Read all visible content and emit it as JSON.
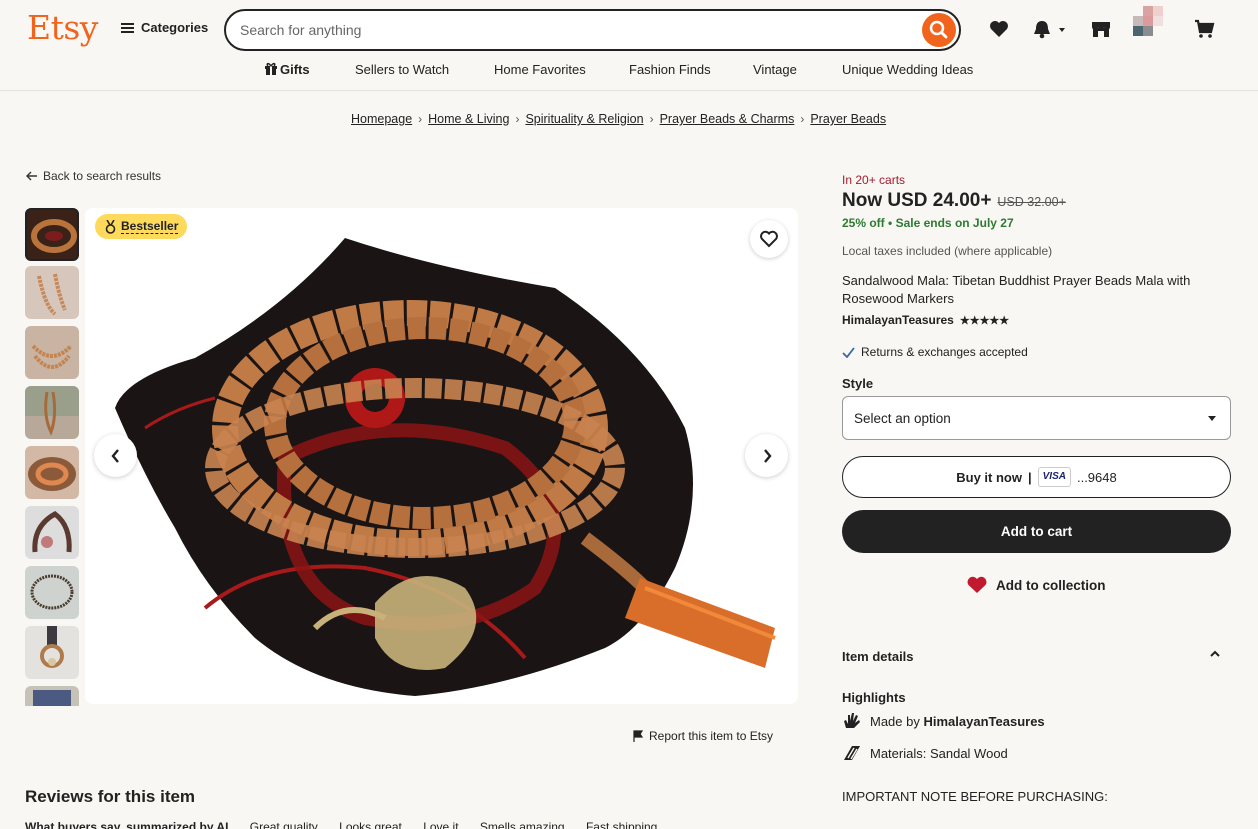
{
  "header": {
    "logo": "Etsy",
    "categories_label": "Categories",
    "search_placeholder": "Search for anything"
  },
  "nav": [
    "Gifts",
    "Sellers to Watch",
    "Home Favorites",
    "Fashion Finds",
    "Vintage",
    "Unique Wedding Ideas"
  ],
  "breadcrumbs": [
    "Homepage",
    "Home & Living",
    "Spirituality & Religion",
    "Prayer Beads & Charms",
    "Prayer Beads"
  ],
  "back_link": "Back to search results",
  "gallery": {
    "badge": "Bestseller",
    "report_link": "Report this item to Etsy"
  },
  "product": {
    "in_carts": "In 20+ carts",
    "price": "Now USD 24.00+",
    "original_price": "USD 32.00+",
    "discount": "25% off",
    "sale_note": "Sale ends on July 27",
    "taxes": "Local taxes included (where applicable)",
    "title": "Sandalwood Mala: Tibetan Buddhist Prayer Beads Mala with Rosewood Markers",
    "shop": "HimalayanTeasures",
    "stars": "★★★★★",
    "returns": "Returns & exchanges accepted",
    "style_label": "Style",
    "style_value": "Select an option",
    "buy_now": "Buy it now",
    "card_brand": "VISA",
    "card_last": "...9648",
    "add_to_cart": "Add to cart",
    "add_to_collection": "Add to collection"
  },
  "details": {
    "header": "Item details",
    "highlights": "Highlights",
    "made_by_prefix": "Made by",
    "made_by_shop": "HimalayanTeasures",
    "materials": "Materials: Sandal Wood",
    "important": "IMPORTANT NOTE BEFORE PURCHASING:"
  },
  "reviews": {
    "title": "Reviews for this item",
    "summary_label": "What buyers say, summarized by AI",
    "tags": [
      "Great quality",
      "Looks great",
      "Love it",
      "Smells amazing",
      "Fast shipping"
    ]
  },
  "colors": {
    "brand": "#f1641e",
    "sale_green": "#2e7a34",
    "carts_red": "#a61a2e",
    "badge_yellow": "#fdd95c"
  }
}
